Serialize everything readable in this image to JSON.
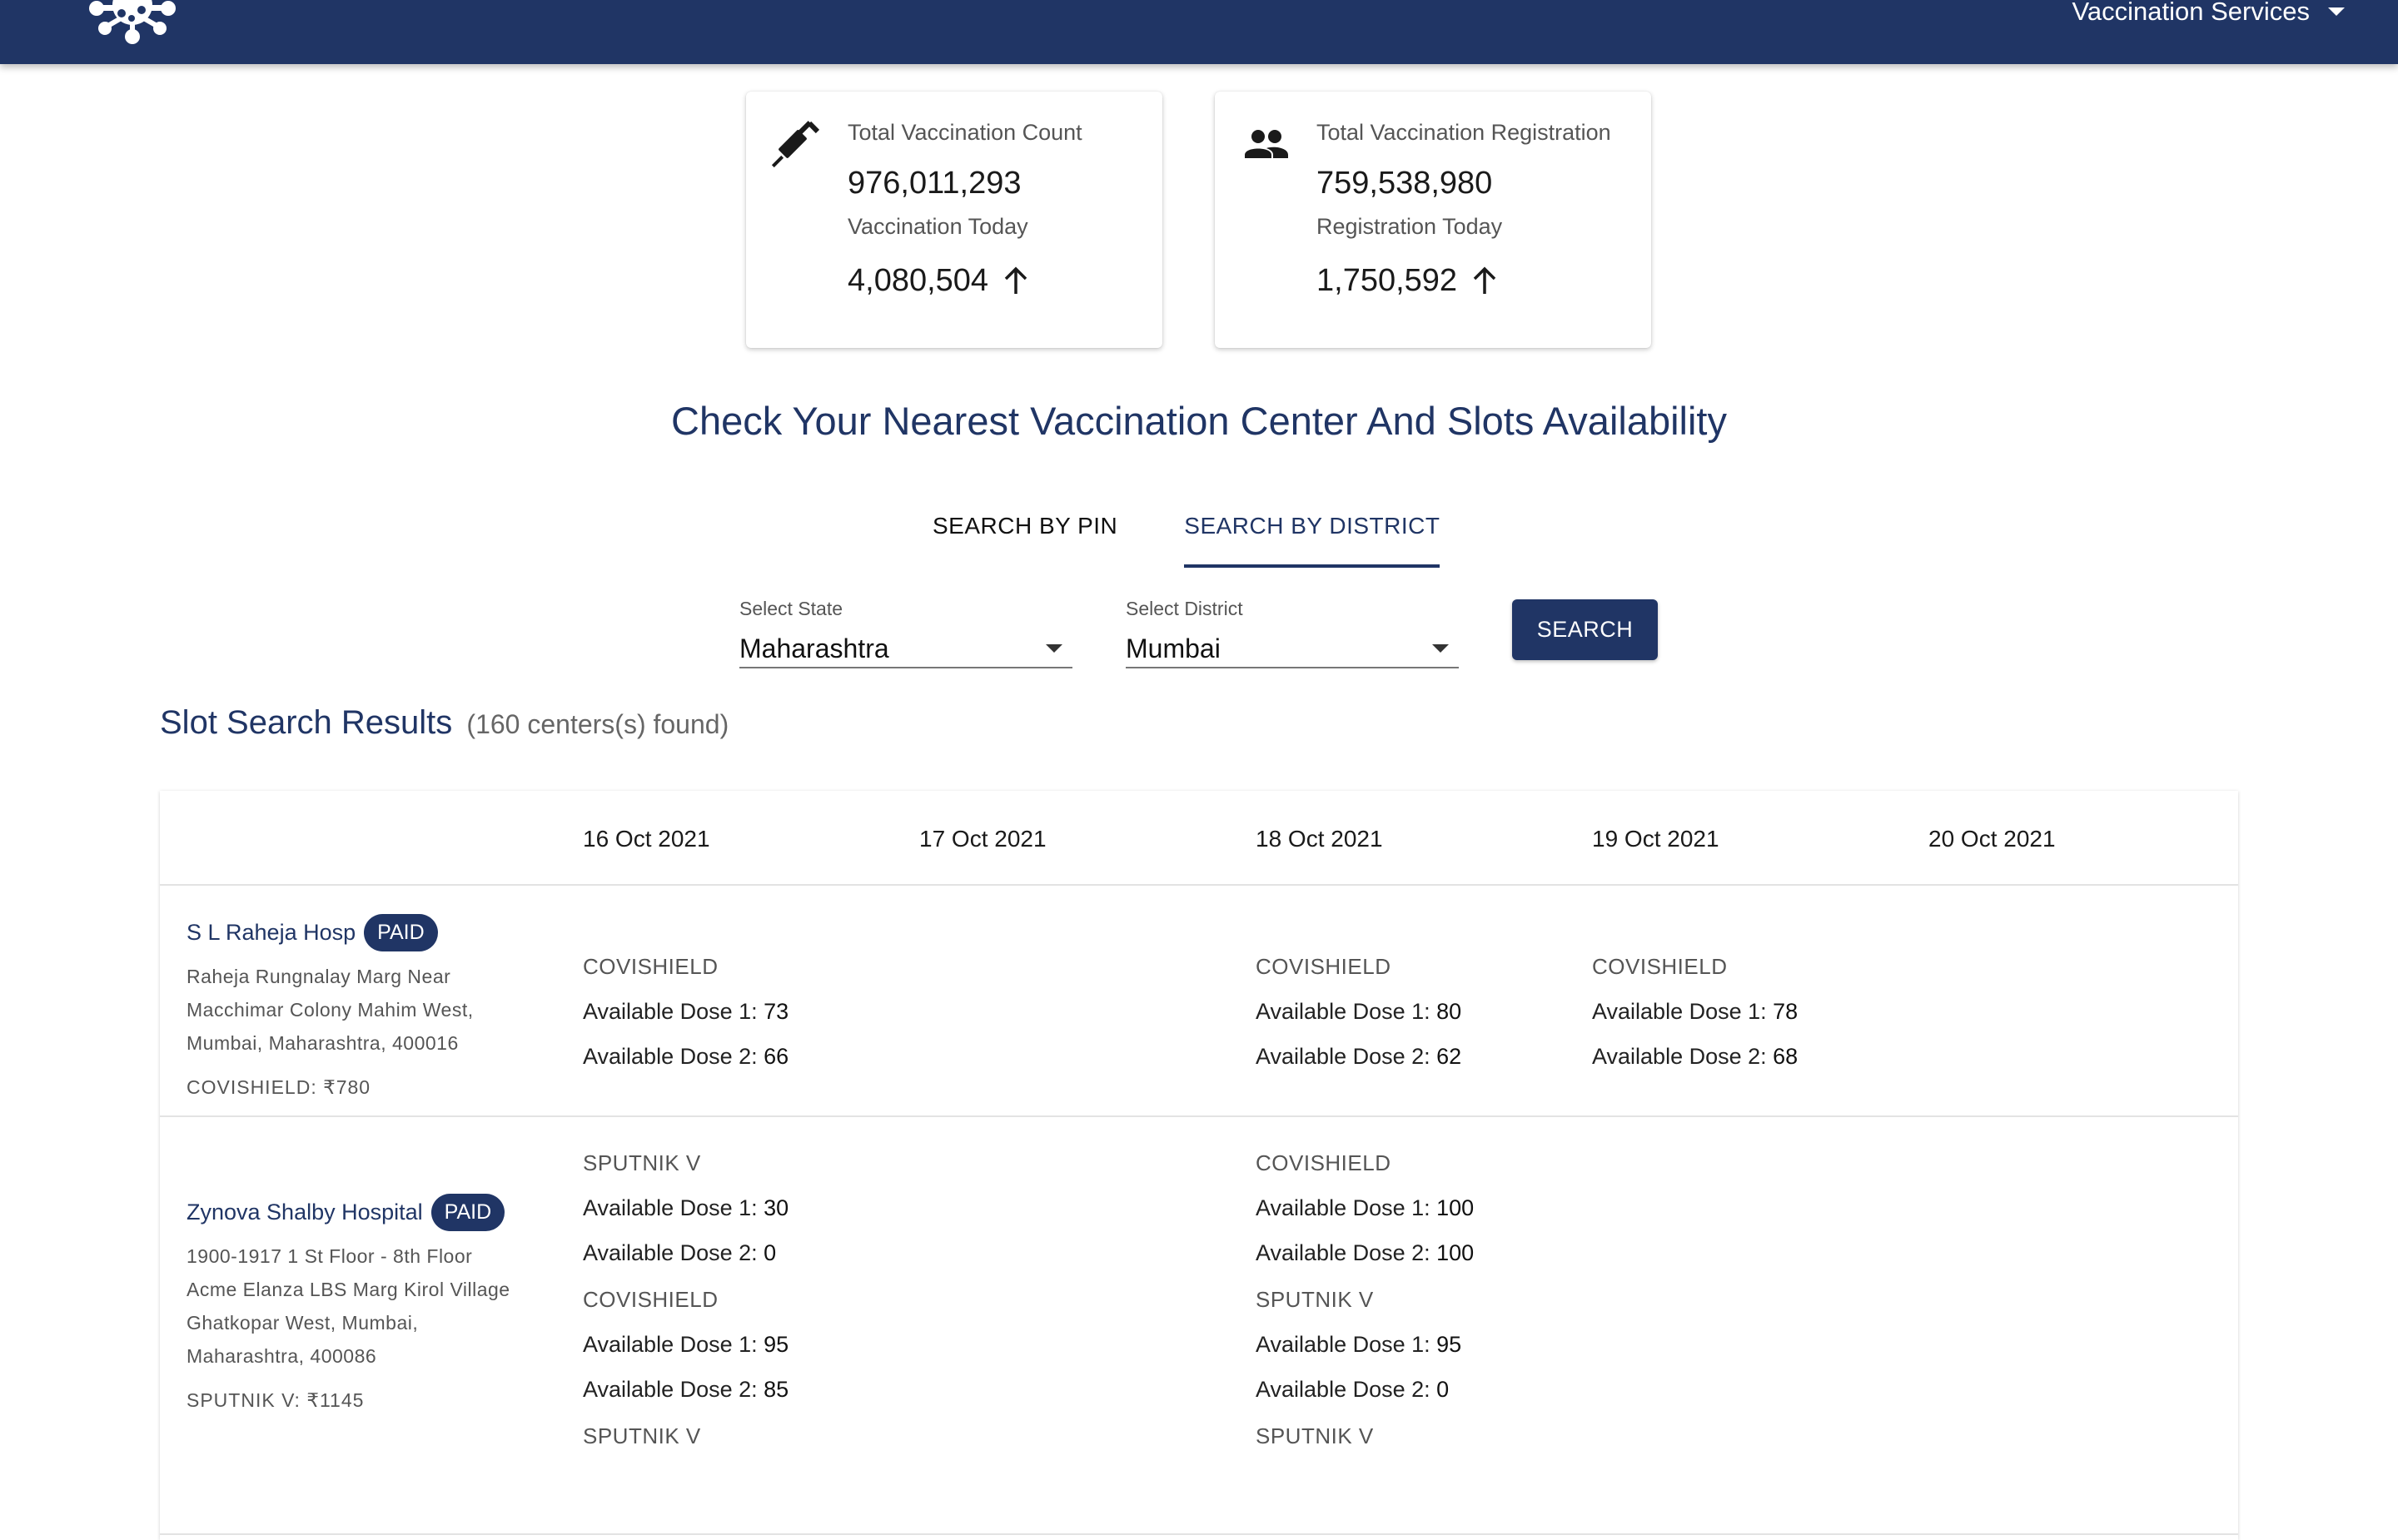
{
  "header": {
    "services_label": "Vaccination Services"
  },
  "stats": [
    {
      "title": "Total Vaccination Count",
      "value": "976,011,293",
      "today_label": "Vaccination Today",
      "today_value": "4,080,504"
    },
    {
      "title": "Total Vaccination Registration",
      "value": "759,538,980",
      "today_label": "Registration Today",
      "today_value": "1,750,592"
    }
  ],
  "main_heading": "Check Your Nearest Vaccination Center And Slots Availability",
  "tabs": [
    {
      "label": "SEARCH BY PIN",
      "active": false
    },
    {
      "label": "SEARCH BY DISTRICT",
      "active": true
    }
  ],
  "filters": {
    "state_label": "Select State",
    "state_value": "Maharashtra",
    "district_label": "Select District",
    "district_value": "Mumbai",
    "search_button": "SEARCH"
  },
  "results": {
    "title": "Slot Search Results",
    "count_text": "(160 centers(s) found)"
  },
  "dates": [
    "16 Oct 2021",
    "17 Oct 2021",
    "18 Oct 2021",
    "19 Oct 2021",
    "20 Oct 2021"
  ],
  "dose1_label": "Available Dose 1: ",
  "dose2_label": "Available Dose 2: ",
  "centers": [
    {
      "name": "S L Raheja Hosp",
      "badge": "PAID",
      "address": [
        "Raheja Rungnalay Marg Near",
        "Macchimar Colony Mahim West,",
        "Mumbai, Maharashtra, 400016"
      ],
      "fees": [
        "COVISHIELD: ₹780"
      ],
      "slots": [
        [
          {
            "vaccine": "COVISHIELD",
            "dose1": "73",
            "dose2": "66"
          }
        ],
        [],
        [
          {
            "vaccine": "COVISHIELD",
            "dose1": "80",
            "dose2": "62"
          }
        ],
        [
          {
            "vaccine": "COVISHIELD",
            "dose1": "78",
            "dose2": "68"
          }
        ],
        []
      ]
    },
    {
      "name": "Zynova Shalby Hospital",
      "badge": "PAID",
      "address": [
        "1900-1917 1 St Floor - 8th Floor",
        "Acme Elanza LBS Marg Kirol Village",
        "Ghatkopar West, Mumbai,",
        "Maharashtra, 400086"
      ],
      "fees": [
        "SPUTNIK V: ₹1145"
      ],
      "slots": [
        [
          {
            "vaccine": "SPUTNIK V",
            "dose1": "30",
            "dose2": "0"
          },
          {
            "vaccine": "COVISHIELD",
            "dose1": "95",
            "dose2": "85"
          },
          {
            "vaccine": "SPUTNIK V"
          }
        ],
        [],
        [
          {
            "vaccine": "COVISHIELD",
            "dose1": "100",
            "dose2": "100"
          },
          {
            "vaccine": "SPUTNIK V",
            "dose1": "95",
            "dose2": "0"
          },
          {
            "vaccine": "SPUTNIK V"
          }
        ],
        [],
        []
      ]
    }
  ]
}
